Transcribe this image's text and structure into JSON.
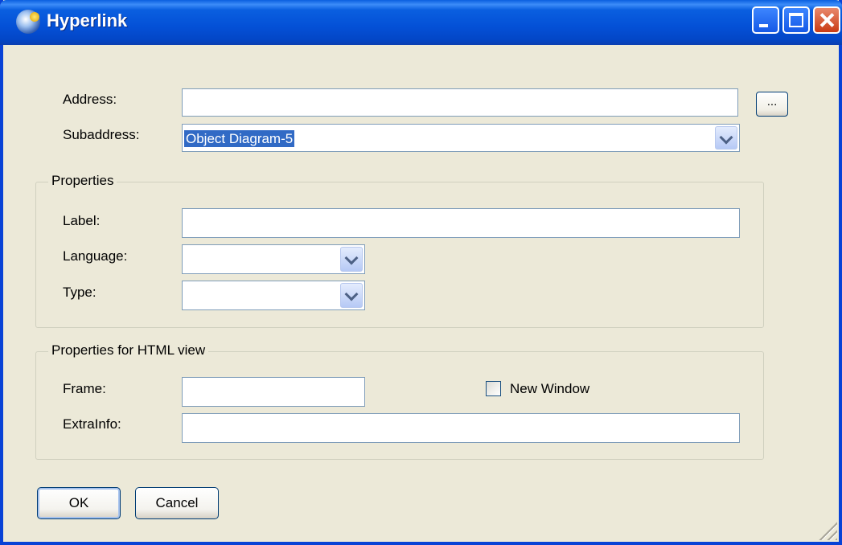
{
  "window": {
    "title": "Hyperlink",
    "app_icon": "globe-icon"
  },
  "fields": {
    "address": {
      "label": "Address:",
      "value": ""
    },
    "browse": {
      "label": "..."
    },
    "subaddress": {
      "label": "Subaddress:",
      "value": "Object Diagram-5"
    }
  },
  "properties": {
    "legend": "Properties",
    "label": {
      "label": "Label:",
      "value": ""
    },
    "language": {
      "label": "Language:",
      "value": ""
    },
    "type": {
      "label": "Type:",
      "value": ""
    }
  },
  "html_view": {
    "legend": "Properties for HTML view",
    "frame": {
      "label": "Frame:",
      "value": ""
    },
    "new_window": {
      "label": "New Window",
      "checked": false
    },
    "extra_info": {
      "label": "ExtraInfo:",
      "value": ""
    }
  },
  "buttons": {
    "ok": "OK",
    "cancel": "Cancel"
  },
  "colors": {
    "titlebar": "#0450d6",
    "dialog_bg": "#ece9d8",
    "selection": "#316ac5",
    "close_button": "#c93a13"
  }
}
